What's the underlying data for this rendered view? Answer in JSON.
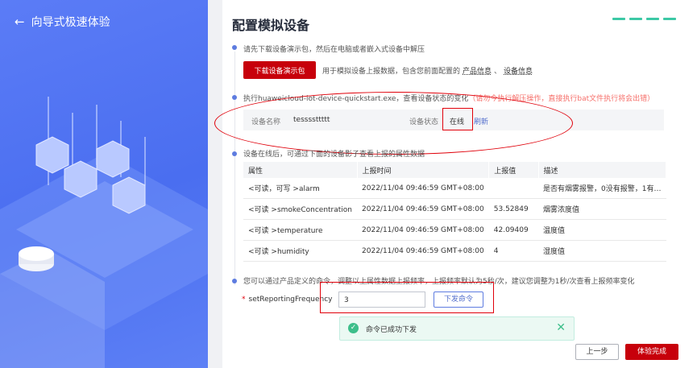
{
  "sidebar": {
    "back_label": "向导式极速体验"
  },
  "page": {
    "title": "配置模拟设备"
  },
  "step1": {
    "text": "请先下载设备演示包，然后在电脑或者嵌入式设备中解压",
    "download_button": "下载设备演示包",
    "desc_prefix": "用于模拟设备上报数据，包含您前面配置的",
    "link_product": "产品信息",
    "sep": "、",
    "link_device": "设备信息"
  },
  "step2": {
    "text": "执行huaweicloud-iot-device-quickstart.exe，查看设备状态的变化",
    "warning": "（请勿今执行解压操作，直接执行bat文件执行将会出错）",
    "device_name_label": "设备名称",
    "device_name_value": "tessssttttt",
    "device_status_label": "设备状态",
    "device_status_value": "在线",
    "refresh_link": "刷新"
  },
  "step3": {
    "text": "设备在线后，可通过下面的设备影子查看上报的属性数据",
    "columns": [
      "属性",
      "上报时间",
      "上报值",
      "描述"
    ],
    "rows": [
      [
        "<可读，可写 >alarm",
        "2022/11/04 09:46:59 GMT+08:00",
        "",
        "是否有烟雾报警，0没有报警，1有…"
      ],
      [
        "<可读 >smokeConcentration",
        "2022/11/04 09:46:59 GMT+08:00",
        "53.52849",
        "烟雾浓度值"
      ],
      [
        "<可读 >temperature",
        "2022/11/04 09:46:59 GMT+08:00",
        "42.09409",
        "温度值"
      ],
      [
        "<可读 >humidity",
        "2022/11/04 09:46:59 GMT+08:00",
        "4",
        "湿度值"
      ]
    ]
  },
  "step4": {
    "text": "您可以通过产品定义的命令，调整以上属性数据上报频率，上报频率默认为5秒/次，建议您调整为1秒/次查看上报频率变化",
    "required_mark": "*",
    "command_label": "setReportingFrequency",
    "command_value": "3",
    "send_button": "下发命令"
  },
  "toast": {
    "message": "命令已成功下发",
    "close": "✕"
  },
  "footer": {
    "prev_button": "上一步",
    "finish_button": "体验完成"
  },
  "colors": {
    "brand_red": "#c7000b",
    "sidebar_blue": "#5b7cf6",
    "success_green": "#3dbe8a",
    "annotation_red": "#e0000a"
  }
}
